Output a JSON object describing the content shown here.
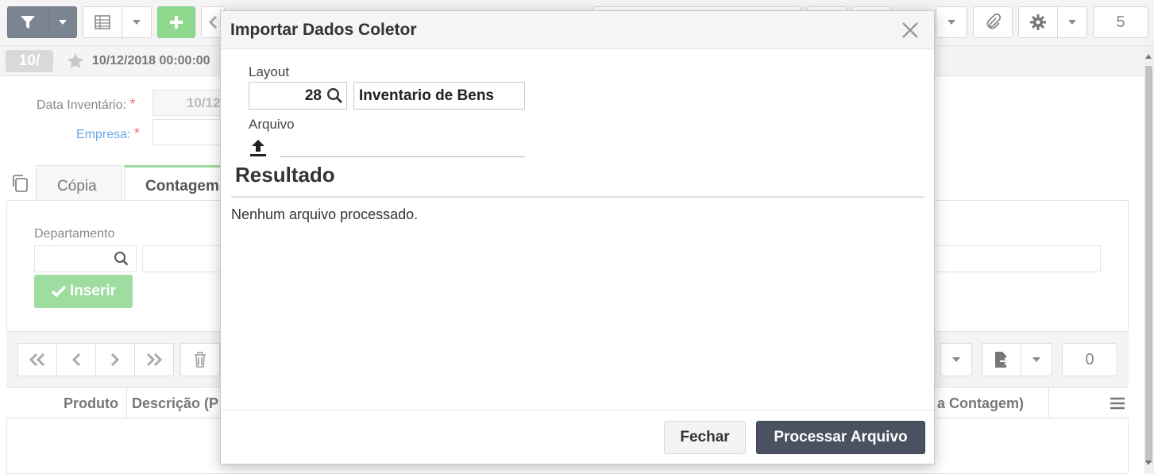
{
  "toolbar": {
    "right_counter": "5"
  },
  "record": {
    "badge": "10/",
    "date": "10/12/2018 00:00:00"
  },
  "form": {
    "data_inventario_label": "Data Inventário:",
    "data_inventario_value": "10/12",
    "empresa_label": "Empresa:",
    "required_mark": "*"
  },
  "tabs": [
    {
      "label": "Cópia"
    },
    {
      "label": "Contagem"
    }
  ],
  "departamento": {
    "label": "Departamento",
    "insert_button": "Inserir"
  },
  "grid": {
    "counter": "0",
    "columns": [
      "Produto",
      "Descrição (P",
      "a Contagem)"
    ]
  },
  "modal": {
    "title": "Importar Dados Coletor",
    "layout_label": "Layout",
    "layout_code": "28",
    "layout_name": "Inventario de Bens",
    "arquivo_label": "Arquivo",
    "result_title": "Resultado",
    "result_text": "Nenhum arquivo processado.",
    "close_button": "Fechar",
    "process_button": "Processar Arquivo"
  },
  "colors": {
    "dark_button": "#4a5160",
    "green_button": "#8fd98f",
    "filter_button": "#7b8491",
    "required": "#e57373",
    "link_label": "#6aa6e8"
  },
  "icons": [
    "filter-icon",
    "table-icon",
    "plus-icon",
    "paperclip-icon",
    "gear-icon",
    "star-icon",
    "search-icon",
    "upload-icon",
    "close-icon",
    "check-icon",
    "first-icon",
    "prev-icon",
    "next-icon",
    "last-icon",
    "trash-icon",
    "export-icon",
    "menu-icon",
    "copy-icon"
  ]
}
